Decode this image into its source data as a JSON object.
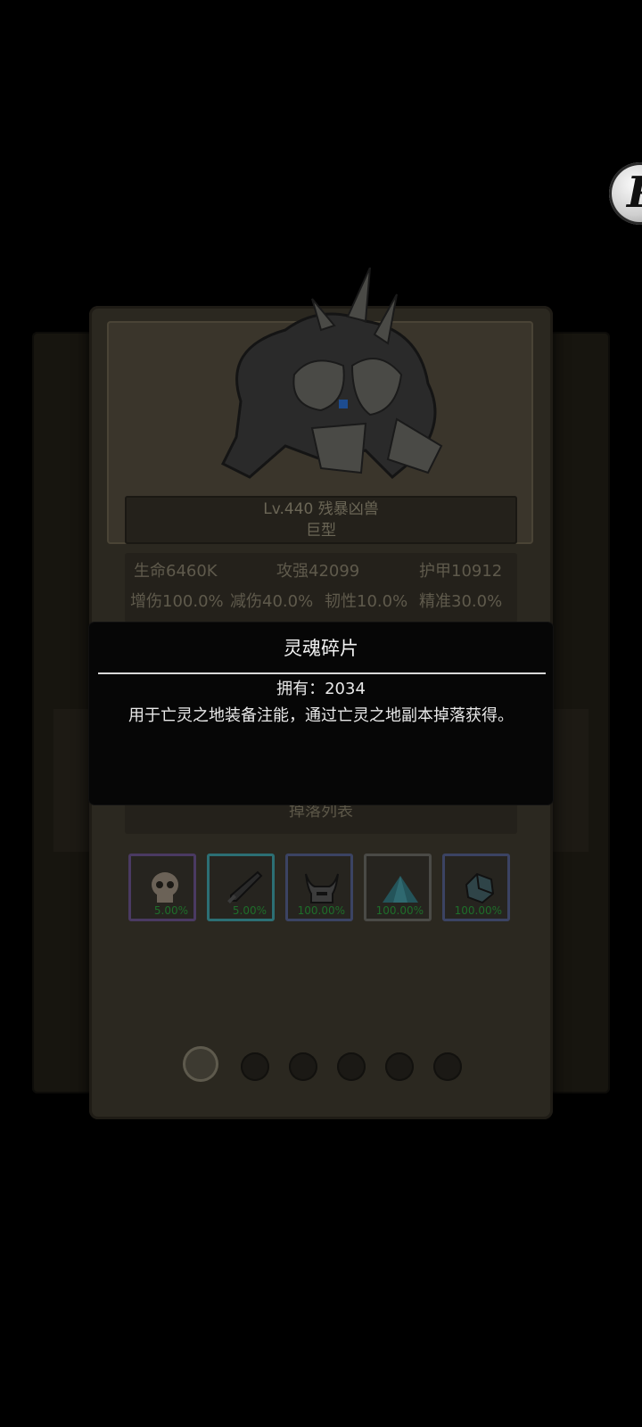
{
  "monster": {
    "name_line": "Lv.440 残暴凶兽",
    "type_line": "巨型"
  },
  "stats": {
    "hp": "生命6460K",
    "attack": "攻强42099",
    "armor": "护甲10912",
    "dmg_bonus": "增伤100.0%",
    "dmg_reduce": "减伤40.0%",
    "toughness": "韧性10.0%",
    "precision": "精准30.0%"
  },
  "drops": {
    "header": "掉落列表",
    "items": [
      {
        "icon": "skull-icon",
        "rate": "5.00%",
        "frame": "#4a3a62"
      },
      {
        "icon": "sword-icon",
        "rate": "5.00%",
        "frame": "#2c6f74"
      },
      {
        "icon": "horned-helmet-icon",
        "rate": "100.00%",
        "frame": "#3b4363"
      },
      {
        "icon": "crystal-pile-icon",
        "rate": "100.00%",
        "frame": "#4a4a46"
      },
      {
        "icon": "ore-icon",
        "rate": "100.00%",
        "frame": "#3b4363"
      }
    ]
  },
  "pager": {
    "count": 6,
    "active": 1
  },
  "tooltip": {
    "title": "灵魂碎片",
    "owned": "拥有：2034",
    "description": "用于亡灵之地装备注能，通过亡灵之地副本掉落获得。"
  },
  "float_button": {
    "glyph": "P"
  }
}
